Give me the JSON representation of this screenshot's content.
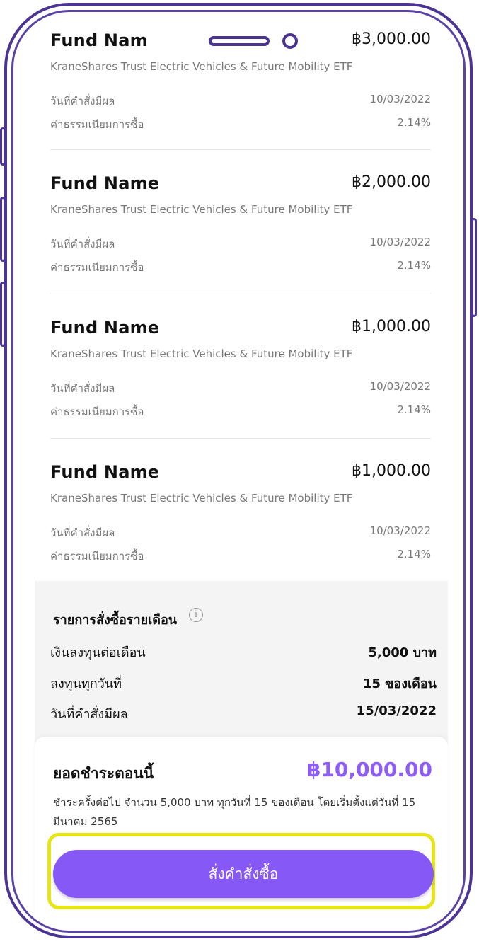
{
  "funds": [
    {
      "name": "Fund Nam",
      "amount": "฿3,000.00",
      "desc": "KraneShares Trust Electric Vehicles & Future Mobility ETF",
      "effective_label": "วันที่คำสั่งมีผล",
      "effective_date": "10/03/2022",
      "fee_label": "ค่าธรรมเนียมการซื้อ",
      "fee": "2.14%"
    },
    {
      "name": "Fund Name",
      "amount": "฿2,000.00",
      "desc": "KraneShares Trust Electric Vehicles & Future Mobility ETF",
      "effective_label": "วันที่คำสั่งมีผล",
      "effective_date": "10/03/2022",
      "fee_label": "ค่าธรรมเนียมการซื้อ",
      "fee": "2.14%"
    },
    {
      "name": "Fund Name",
      "amount": "฿1,000.00",
      "desc": "KraneShares Trust Electric Vehicles & Future Mobility ETF",
      "effective_label": "วันที่คำสั่งมีผล",
      "effective_date": "10/03/2022",
      "fee_label": "ค่าธรรมเนียมการซื้อ",
      "fee": "2.14%"
    },
    {
      "name": "Fund Name",
      "amount": "฿1,000.00",
      "desc": "KraneShares Trust Electric Vehicles & Future Mobility ETF",
      "effective_label": "วันที่คำสั่งมีผล",
      "effective_date": "10/03/2022",
      "fee_label": "ค่าธรรมเนียมการซื้อ",
      "fee": "2.14%"
    }
  ],
  "monthly": {
    "title": "รายการสั่งซื้อรายเดือน",
    "info_icon": "i",
    "rows": [
      {
        "label": "เงินลงทุนต่อเดือน",
        "value": "5,000 บาท"
      },
      {
        "label": "ลงทุนทุกวันที่",
        "value": "15 ของเดือน"
      },
      {
        "label": "วันที่คำสั่งมีผล",
        "value": "15/03/2022"
      }
    ]
  },
  "payment": {
    "title": "ยอดชำระตอนนี้",
    "amount": "฿10,000.00",
    "note": "ชำระครั้งต่อไป จำนวน 5,000 บาท ทุกวันที่ 15 ของเดือน โดยเริ่มตั้งแต่วันที่ 15 มีนาคม 2565",
    "button_label": "สั่งคำสั่งซื้อ"
  },
  "colors": {
    "accent": "#8658f5",
    "amount": "#8e5cf7",
    "frame": "#4c3494",
    "highlight": "#e5e51a"
  }
}
